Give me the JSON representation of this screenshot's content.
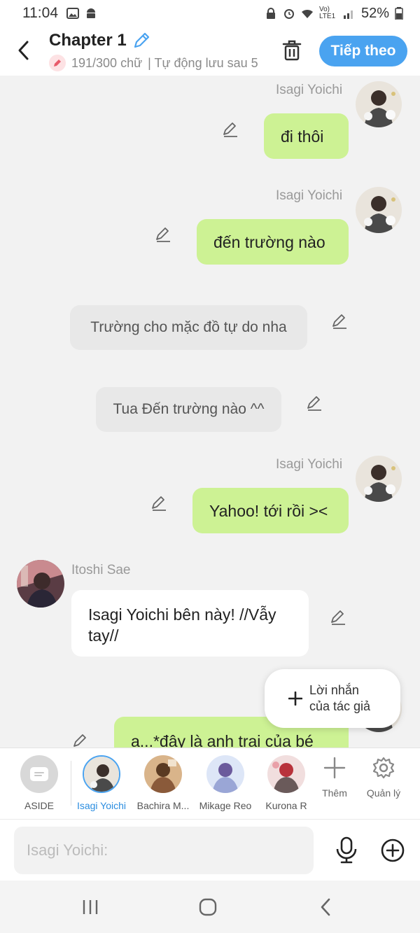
{
  "status_bar": {
    "time": "11:04",
    "battery": "52%",
    "network": "Vo) LTE1"
  },
  "header": {
    "title": "Chapter 1",
    "word_count": "191/300 chữ",
    "autosave": "| Tự động lưu sau 5",
    "next_label": "Tiếp theo"
  },
  "messages": [
    {
      "type": "right",
      "sender": "Isagi Yoichi",
      "text": "đi thôi"
    },
    {
      "type": "right",
      "sender": "Isagi Yoichi",
      "text": "đến trường nào"
    },
    {
      "type": "narration",
      "text": "Trường cho mặc đồ tự do nha"
    },
    {
      "type": "narration",
      "text": "Tua Đến trường nào ^^"
    },
    {
      "type": "right",
      "sender": "Isagi Yoichi",
      "text": "Yahoo! tới rồi ><"
    },
    {
      "type": "left",
      "sender": "Itoshi Sae",
      "text": "Isagi Yoichi bên này! //Vẫy tay//"
    },
    {
      "type": "right",
      "sender": "",
      "text": "a...*đây là anh trai của bé"
    }
  ],
  "author_note": {
    "line1": "Lời nhắn",
    "line2": "của tác giả"
  },
  "characters": [
    {
      "name": "ASIDE",
      "active": false
    },
    {
      "name": "Isagi Yoichi",
      "active": true
    },
    {
      "name": "Bachira M...",
      "active": false
    },
    {
      "name": "Mikage Reo",
      "active": false
    },
    {
      "name": "Kurona R",
      "active": false
    }
  ],
  "tools": {
    "add_label": "Thêm",
    "manage_label": "Quản lý"
  },
  "input": {
    "placeholder": "Isagi Yoichi:"
  },
  "colors": {
    "accent": "#4aa3f0",
    "bubble_green": "#cdf294",
    "narration_gray": "#e8e8e8"
  }
}
